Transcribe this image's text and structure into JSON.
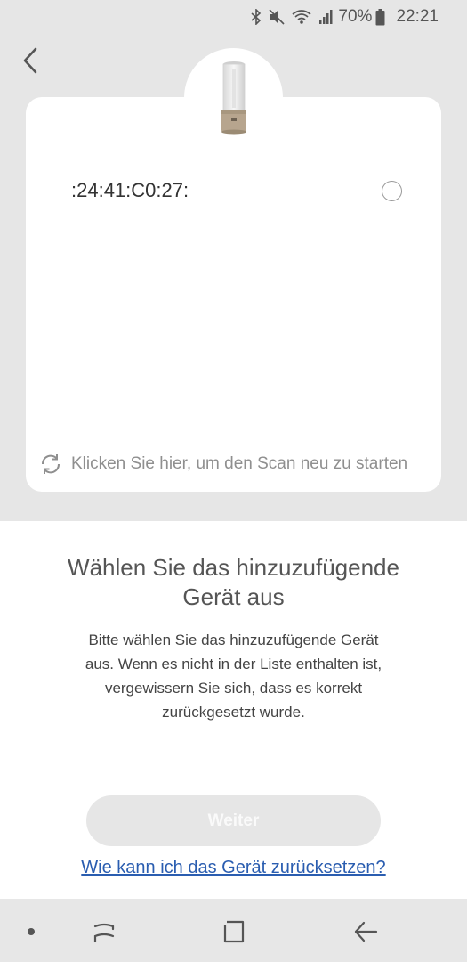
{
  "status_bar": {
    "battery_percent": "70%",
    "time": "22:21",
    "icons": [
      "bluetooth-icon",
      "mute-icon",
      "wifi-icon",
      "signal-icon",
      "battery-icon"
    ]
  },
  "header": {
    "back_icon": "back-arrow-icon",
    "device_image": "lamp-device-image"
  },
  "device_list": {
    "items": [
      {
        "name": ":24:41:C0:27:",
        "selected": false
      }
    ]
  },
  "rescan": {
    "icon": "refresh-icon",
    "label": "Klicken Sie hier, um den Scan neu zu starten"
  },
  "main": {
    "title": "Wählen Sie das hinzuzufügende Gerät aus",
    "description": "Bitte wählen Sie das hinzuzufügende Gerät aus. Wenn es nicht in der Liste enthalten ist, vergewissern Sie sich, dass es korrekt zurückgesetzt wurde.",
    "next_button": "Weiter",
    "reset_link": "Wie kann ich das Gerät zurücksetzen?"
  },
  "nav_bar": {
    "items": [
      "dot-icon",
      "recent-apps-icon",
      "home-icon",
      "back-icon"
    ]
  },
  "colors": {
    "background_top": "#e6e6e6",
    "card": "#ffffff",
    "link": "#2a5db0",
    "button_disabled": "#e6e6e6"
  }
}
